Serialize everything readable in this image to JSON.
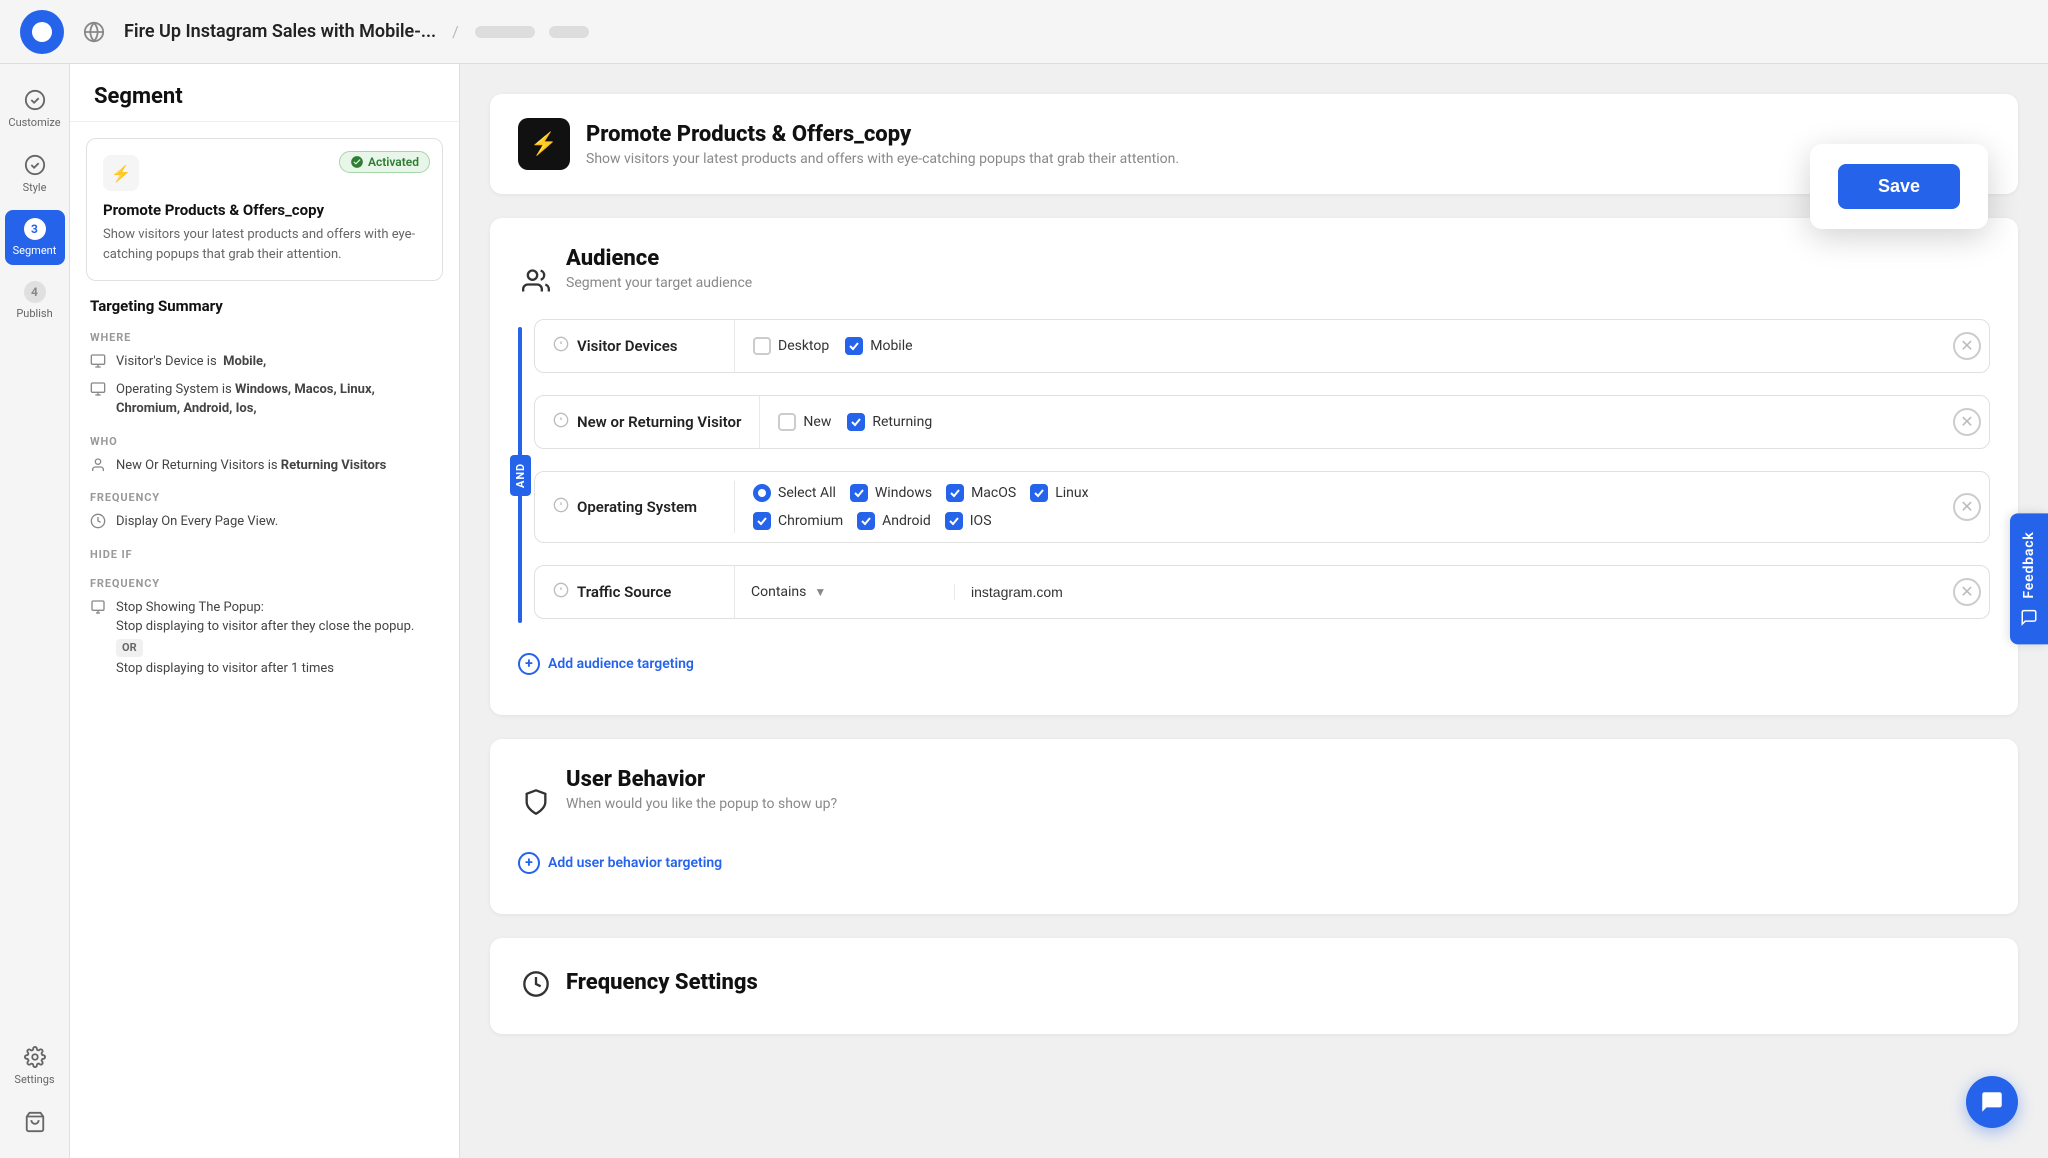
{
  "topbar": {
    "title": "Fire Up Instagram Sales with Mobile-...",
    "breadcrumb": "..."
  },
  "left_nav": {
    "items": [
      {
        "id": "customize",
        "label": "Customize",
        "icon": "check-circle",
        "badge": null,
        "active": false
      },
      {
        "id": "style",
        "label": "Style",
        "icon": "check-circle",
        "badge": null,
        "active": false
      },
      {
        "id": "segment",
        "label": "Segment",
        "icon": null,
        "badge": "3",
        "active": true
      },
      {
        "id": "publish",
        "label": "Publish",
        "icon": null,
        "badge": "4",
        "active": false
      }
    ],
    "settings_label": "Settings"
  },
  "sidebar": {
    "header": "Segment",
    "card": {
      "activated_label": "Activated",
      "title": "Promote Products & Offers_copy",
      "description": "Show visitors your latest products and offers with eye-catching popups that grab their attention."
    },
    "targeting_summary": {
      "title": "Targeting Summary",
      "where_label": "WHERE",
      "where_items": [
        {
          "icon": "monitor",
          "text": "Visitor's Device is  Mobile,"
        },
        {
          "icon": "monitor",
          "text": "Operating System is Windows, Macos, Linux, Chromium, Android, Ios,"
        }
      ],
      "who_label": "WHO",
      "who_items": [
        {
          "icon": "person",
          "text": "New Or Returning Visitors is Returning Visitors"
        }
      ],
      "frequency_label": "FREQUENCY",
      "frequency_items": [
        {
          "icon": "clock",
          "text": "Display On Every Page View."
        }
      ],
      "hide_if_label": "Hide if",
      "hide_frequency_label": "FREQUENCY",
      "hide_items": [
        {
          "icon": "popup",
          "text": "Stop Showing The Popup:\nStop displaying to visitor after they close the popup.",
          "or": true,
          "or_text": "OR",
          "extra": "Stop displaying to visitor after 1 times"
        }
      ]
    }
  },
  "save_button": {
    "label": "Save"
  },
  "campaign": {
    "title": "Promote Products & Offers_copy",
    "subtitle": "Show visitors your latest products and offers with eye-catching popups that grab their attention."
  },
  "audience_section": {
    "title": "Audience",
    "subtitle": "Segment your target audience",
    "and_label": "AND",
    "rows": [
      {
        "id": "visitor-devices",
        "label": "Visitor Devices",
        "options": [
          {
            "type": "checkbox",
            "label": "Desktop",
            "checked": false
          },
          {
            "type": "checkbox",
            "label": "Mobile",
            "checked": true
          }
        ]
      },
      {
        "id": "new-returning",
        "label": "New or Returning Visitor",
        "options": [
          {
            "type": "checkbox",
            "label": "New",
            "checked": false
          },
          {
            "type": "checkbox",
            "label": "Returning",
            "checked": true
          }
        ]
      },
      {
        "id": "operating-system",
        "label": "Operating System",
        "options": [
          {
            "type": "radio",
            "label": "Select All",
            "checked": true
          },
          {
            "type": "checkbox",
            "label": "Windows",
            "checked": true
          },
          {
            "type": "checkbox",
            "label": "MacOS",
            "checked": true
          },
          {
            "type": "checkbox",
            "label": "Linux",
            "checked": true
          },
          {
            "type": "checkbox",
            "label": "Chromium",
            "checked": true
          },
          {
            "type": "checkbox",
            "label": "Android",
            "checked": true
          },
          {
            "type": "checkbox",
            "label": "IOS",
            "checked": true
          }
        ]
      },
      {
        "id": "traffic-source",
        "label": "Traffic Source",
        "condition": "Contains",
        "value": "instagram.com",
        "type": "input"
      }
    ],
    "add_label": "Add audience targeting"
  },
  "user_behavior_section": {
    "title": "User Behavior",
    "subtitle": "When would you like the popup to show up?",
    "add_label": "Add user behavior targeting"
  },
  "frequency_section": {
    "title": "Frequency Settings"
  },
  "feedback_tab": {
    "label": "Feedback"
  },
  "chat_button": {
    "label": "Chat"
  }
}
